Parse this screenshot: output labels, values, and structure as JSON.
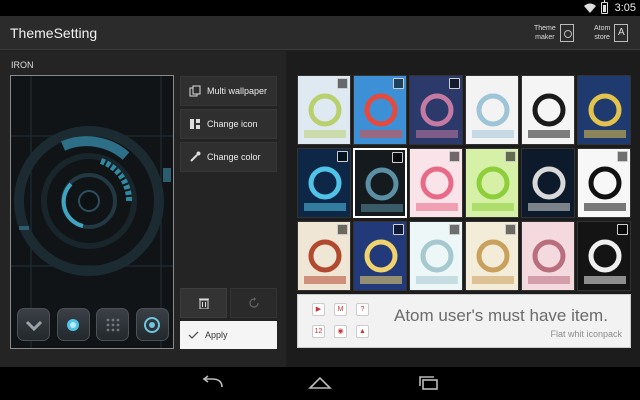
{
  "status": {
    "time": "3:05",
    "icons": [
      "wifi-icon",
      "battery-icon"
    ]
  },
  "app": {
    "title": "ThemeSetting"
  },
  "actions": {
    "theme_maker": {
      "line1": "Theme",
      "line2": "maker",
      "icon": "theme-maker-icon"
    },
    "atom_store": {
      "line1": "Atom",
      "line2": "store",
      "icon": "atom-store-icon",
      "glyph": "A"
    }
  },
  "theme": {
    "name": "IRON"
  },
  "dock_icons": [
    "phone-icon",
    "camera-icon",
    "apps-icon",
    "browser-icon"
  ],
  "buttons": {
    "multi_wallpaper": "Multi wallpaper",
    "change_icon": "Change icon",
    "change_color": "Change color",
    "apply": "Apply"
  },
  "themes": [
    {
      "name": "town",
      "bg": "#dfe9f1",
      "accent": "#b9d06f",
      "badge": true,
      "selected": false
    },
    {
      "name": "colorful",
      "bg": "#3d8fd6",
      "accent": "#e64a3c",
      "badge": true,
      "selected": false
    },
    {
      "name": "night-trees",
      "bg": "#2b3a6a",
      "accent": "#c47aa3",
      "badge": true,
      "selected": false
    },
    {
      "name": "white-line",
      "bg": "#f3f3f3",
      "accent": "#9ec4d8",
      "badge": false,
      "selected": false
    },
    {
      "name": "headphones-skull",
      "bg": "#f5f5f5",
      "accent": "#1a1a1a",
      "badge": false,
      "selected": false
    },
    {
      "name": "starry-night",
      "bg": "#1e3a6e",
      "accent": "#e3c24d",
      "badge": false,
      "selected": false
    },
    {
      "name": "fireworks",
      "bg": "#0f2747",
      "accent": "#4fc3e8",
      "badge": true,
      "selected": false
    },
    {
      "name": "iron",
      "bg": "#141a1e",
      "accent": "#5a8fa4",
      "badge": true,
      "selected": true
    },
    {
      "name": "blossom",
      "bg": "#fbe3ea",
      "accent": "#e96a86",
      "badge": true,
      "selected": false
    },
    {
      "name": "spring-tree",
      "bg": "#d7f0a8",
      "accent": "#8ccf3a",
      "badge": true,
      "selected": false
    },
    {
      "name": "starry-night-text",
      "bg": "#0d1a2c",
      "accent": "#d9d9d9",
      "badge": false,
      "selected": false
    },
    {
      "name": "black-white",
      "bg": "#f7f7f7",
      "accent": "#111111",
      "badge": true,
      "selected": false
    },
    {
      "name": "my-little-item",
      "bg": "#efe6d6",
      "accent": "#b2492f",
      "badge": true,
      "selected": false
    },
    {
      "name": "moon-boy",
      "bg": "#233a7a",
      "accent": "#f1d36b",
      "badge": true,
      "selected": false
    },
    {
      "name": "castle",
      "bg": "#eef7f7",
      "accent": "#a6c9d0",
      "badge": true,
      "selected": false
    },
    {
      "name": "girl-balloon",
      "bg": "#f3ecd8",
      "accent": "#c9a15c",
      "badge": true,
      "selected": false
    },
    {
      "name": "eiffel",
      "bg": "#f4d9df",
      "accent": "#b86e7d",
      "badge": false,
      "selected": false
    },
    {
      "name": "dark-mono",
      "bg": "#141414",
      "accent": "#f0f0f0",
      "badge": true,
      "selected": false
    }
  ],
  "banner": {
    "title": "Atom user's must have item.",
    "subtitle": "Flat whit iconpack",
    "icons": [
      {
        "name": "play-icon",
        "glyph": "▶"
      },
      {
        "name": "gmail-icon",
        "glyph": "M"
      },
      {
        "name": "maps-icon",
        "glyph": "?"
      },
      {
        "name": "calendar-icon",
        "glyph": "12"
      },
      {
        "name": "camera-icon",
        "glyph": "◉"
      },
      {
        "name": "gallery-icon",
        "glyph": "▲"
      }
    ]
  },
  "nav": [
    "back-icon",
    "home-icon",
    "recents-icon"
  ]
}
